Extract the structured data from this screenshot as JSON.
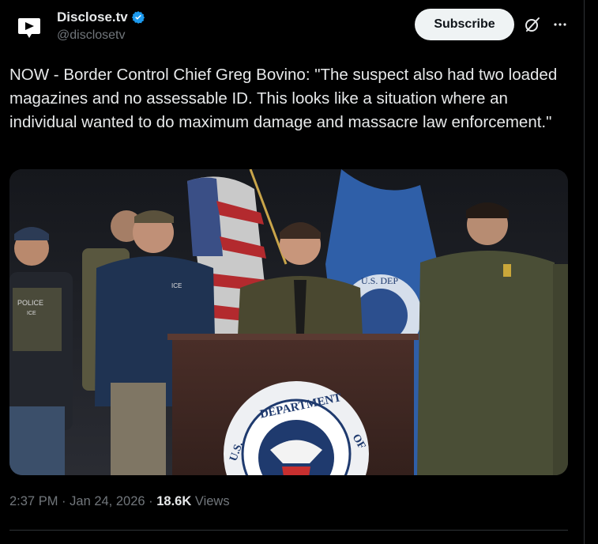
{
  "author": {
    "display_name": "Disclose.tv",
    "handle": "@disclosetv"
  },
  "actions": {
    "subscribe_label": "Subscribe",
    "grok_icon": "grok-icon",
    "more_icon": "more-icon"
  },
  "tweet": {
    "text": "NOW - Border Control Chief Greg Bovino: \"The suspect also had two loaded magazines and no assessable ID. This looks like a situation where an individual wanted to do maximum damage and massacre law enforcement.\""
  },
  "media": {
    "vest_text_1": "POLICE",
    "vest_text_2": "ICE",
    "jacket_text": "ICE",
    "seal_text": "DEPARTMENT",
    "seal_left": "U.S.",
    "seal_right": "OF",
    "flag_text": "U.S. DEP"
  },
  "meta": {
    "time": "2:37 PM",
    "separator": "·",
    "date": "Jan 24, 2026",
    "views_count": "18.6K",
    "views_label": "Views"
  },
  "colors": {
    "background": "#000000",
    "text": "#e7e9ea",
    "secondary_text": "#71767b",
    "verified": "#1d9bf0",
    "button_bg": "#eff3f4"
  }
}
